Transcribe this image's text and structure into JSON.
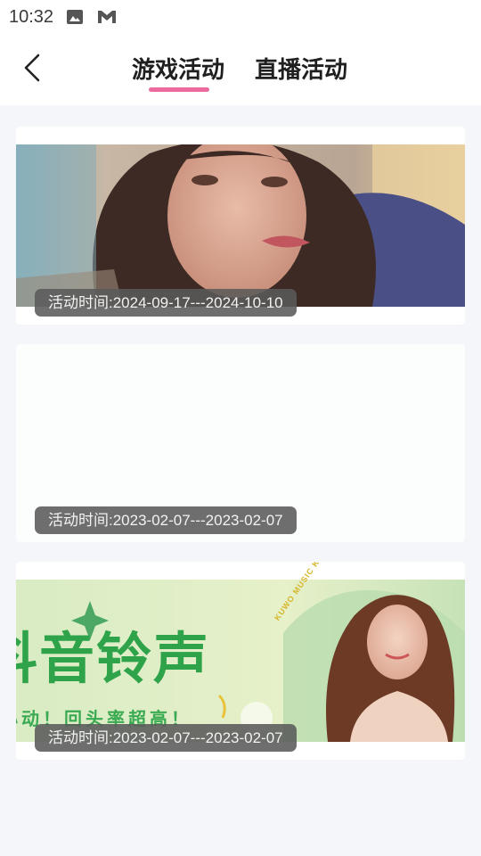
{
  "status_bar": {
    "time": "10:32",
    "icons": [
      "image-icon",
      "mail-icon"
    ]
  },
  "header": {
    "back_icon": "chevron-left-icon",
    "tabs": [
      {
        "label": "游戏活动",
        "active": true
      },
      {
        "label": "直播活动",
        "active": false
      }
    ],
    "active_color": "#ec6a9d"
  },
  "cards": [
    {
      "date_label": "活动时间:2024-09-17---2024-10-10",
      "image": "portrait-photo"
    },
    {
      "date_label": "活动时间:2023-02-07---2023-02-07",
      "image": "blank"
    },
    {
      "date_label": "活动时间:2023-02-07---2023-02-07",
      "image": "ringtone-banner",
      "banner_text": {
        "headline": "抖音铃声",
        "subline": "心动！回头率超高！",
        "brand": "KUWO MUSIC KUWO MUSIC"
      }
    }
  ]
}
